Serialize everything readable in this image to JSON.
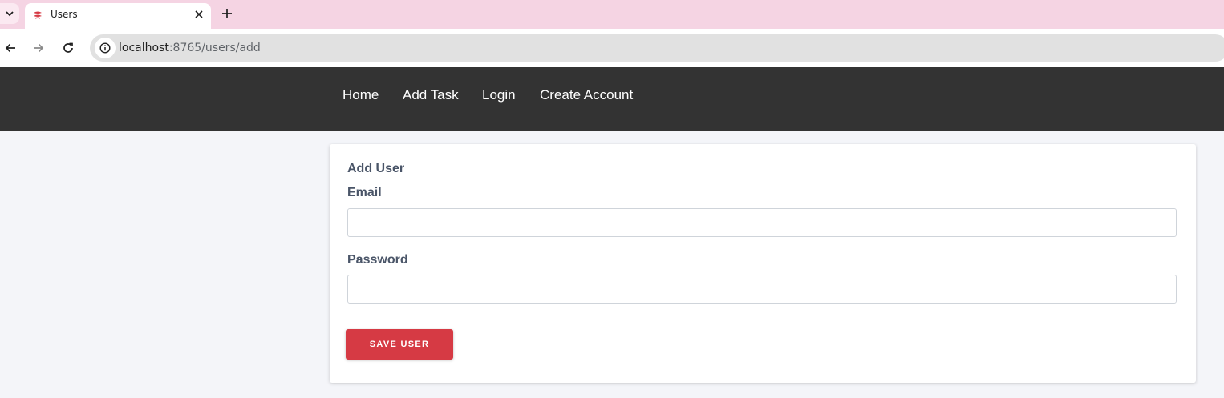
{
  "browser": {
    "tab": {
      "title": "Users",
      "favicon": "app-favicon",
      "accent": "#d63a44"
    },
    "toolbar": {
      "url_host": "localhost",
      "url_rest": ":8765/users/add"
    },
    "colors": {
      "tabstrip": "#f5d4e3"
    }
  },
  "nav": {
    "items": [
      {
        "label": "Home"
      },
      {
        "label": "Add Task"
      },
      {
        "label": "Login"
      },
      {
        "label": "Create Account"
      }
    ],
    "background": "#333333"
  },
  "form": {
    "title": "Add User",
    "email": {
      "label": "Email",
      "value": "",
      "placeholder": ""
    },
    "password": {
      "label": "Password",
      "value": "",
      "placeholder": ""
    },
    "submit_label": "Save User",
    "button_color": "#d63a44"
  }
}
